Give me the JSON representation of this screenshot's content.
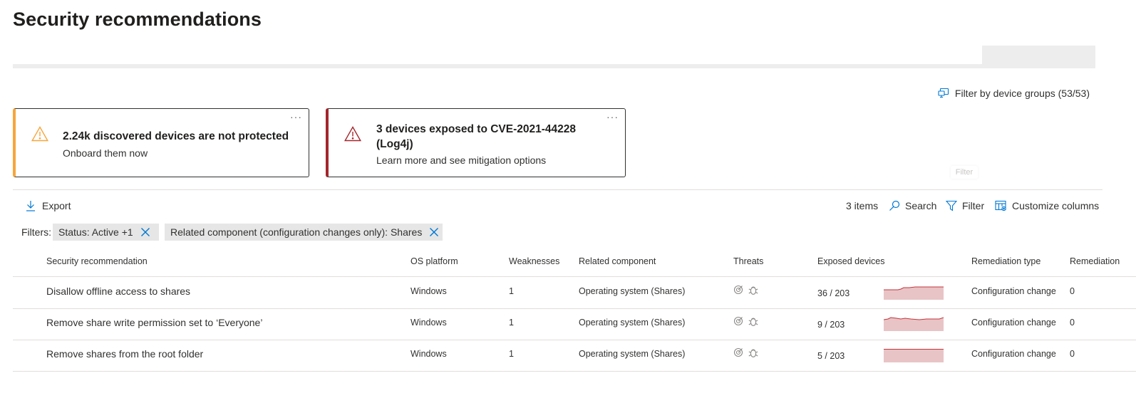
{
  "page": {
    "title": "Security recommendations"
  },
  "filter_device_groups": {
    "label": "Filter by device groups (53/53)"
  },
  "cards": [
    {
      "title": "2.24k discovered devices are not protected",
      "subtitle": "Onboard them now",
      "more": "···",
      "accent": "#f7a53a"
    },
    {
      "title_line1": "3 devices exposed to CVE-2021-44228",
      "title_line2": "(Log4j)",
      "subtitle": "Learn more and see mitigation options",
      "more": "···",
      "accent": "#a4262c"
    }
  ],
  "ghost_tooltip": "Filter",
  "toolbar": {
    "export_label": "Export",
    "items_count": "3 items",
    "search_label": "Search",
    "filter_label": "Filter",
    "customize_label": "Customize columns"
  },
  "filters": {
    "label": "Filters:",
    "chips": [
      {
        "text": "Status: Active +1"
      },
      {
        "text": "Related component (configuration changes only): Shares"
      }
    ]
  },
  "table": {
    "columns": [
      "Security recommendation",
      "OS platform",
      "Weaknesses",
      "Related component",
      "Threats",
      "Exposed devices",
      "Remediation type",
      "Remediation"
    ],
    "rows": [
      {
        "recommendation": "Disallow offline access to shares",
        "os": "Windows",
        "weaknesses": "1",
        "component": "Operating system (Shares)",
        "exposed": "36 / 203",
        "remediation_type": "Configuration change",
        "remediation": "0"
      },
      {
        "recommendation": "Remove share write permission set to ‘Everyone’",
        "os": "Windows",
        "weaknesses": "1",
        "component": "Operating system (Shares)",
        "exposed": "9 / 203",
        "remediation_type": "Configuration change",
        "remediation": "0"
      },
      {
        "recommendation": "Remove shares from the root folder",
        "os": "Windows",
        "weaknesses": "1",
        "component": "Operating system (Shares)",
        "exposed": "5 / 203",
        "remediation_type": "Configuration change",
        "remediation": "0"
      }
    ]
  },
  "icons": {
    "warning": "warning-triangle-icon",
    "device_groups": "device-groups-icon",
    "export": "download-arrow-icon",
    "search": "search-icon",
    "filter": "funnel-icon",
    "customize": "table-settings-icon",
    "remove": "close-icon",
    "threat_target": "target-icon",
    "threat_bug": "bug-icon"
  },
  "colors": {
    "accent_blue": "#0078d4",
    "warning_orange": "#f7a53a",
    "critical_red": "#a4262c",
    "spark_fill": "#e8c4c6",
    "spark_line": "#c5353d"
  }
}
